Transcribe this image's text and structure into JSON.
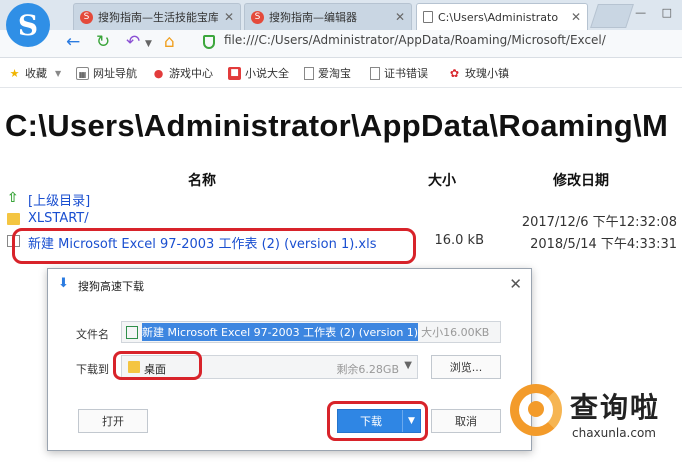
{
  "browser": {
    "logo_letter": "S",
    "tabs": [
      {
        "label": "搜狗指南—生活技能宝库",
        "close": "✕",
        "active": false
      },
      {
        "label": "搜狗指南—编辑器",
        "close": "✕",
        "active": false
      },
      {
        "label": "C:\\Users\\Administrato",
        "close": "✕",
        "active": true
      }
    ],
    "window_controls": "— □",
    "nav_icons": [
      "back-arrow-icon",
      "refresh-icon",
      "undo-icon",
      "dropdown-icon",
      "home-icon"
    ],
    "address": "file:///C:/Users/Administrator/AppData/Roaming/Microsoft/Excel/",
    "bookmarks": [
      {
        "label": "收藏",
        "icon": "star-icon"
      },
      {
        "label": "网址导航",
        "icon": "nav-icon"
      },
      {
        "label": "游戏中心",
        "icon": "game-icon"
      },
      {
        "label": "小说大全",
        "icon": "book-icon"
      },
      {
        "label": "爱淘宝",
        "icon": "page-icon"
      },
      {
        "label": "证书错误",
        "icon": "page-icon"
      },
      {
        "label": "玫瑰小镇",
        "icon": "rose-icon"
      }
    ]
  },
  "listing": {
    "title": "C:\\Users\\Administrator\\AppData\\Roaming\\M",
    "columns": {
      "name": "名称",
      "size": "大小",
      "date": "修改日期"
    },
    "rows": [
      {
        "name": "[上级目录]",
        "size": "",
        "date": "",
        "icon": "up-folder-icon"
      },
      {
        "name": "XLSTART/",
        "size": "",
        "date": "2017/12/6 下午12:32:08",
        "icon": "folder-icon"
      },
      {
        "name": "新建 Microsoft Excel 97-2003 工作表 (2) (version 1).xls",
        "size": "16.0 kB",
        "date": "2018/5/14 下午4:33:31",
        "icon": "file-icon"
      }
    ]
  },
  "dialog": {
    "title": "搜狗高速下载",
    "filename_label": "文件名",
    "filename": "新建 Microsoft Excel 97-2003 工作表 (2) (version 1)",
    "filesize": "大小16.00KB",
    "saveto_label": "下载到",
    "saveto": "桌面",
    "free_space": "剩余6.28GB",
    "browse": "浏览...",
    "open": "打开",
    "download": "下载",
    "cancel": "取消"
  },
  "watermark": {
    "brand": "查询啦",
    "url": "chaxunla.com"
  },
  "colors": {
    "accent": "#2f86e4",
    "link": "#1a4fd0",
    "annotation": "#d8232a",
    "brand": "#f39b2a"
  }
}
